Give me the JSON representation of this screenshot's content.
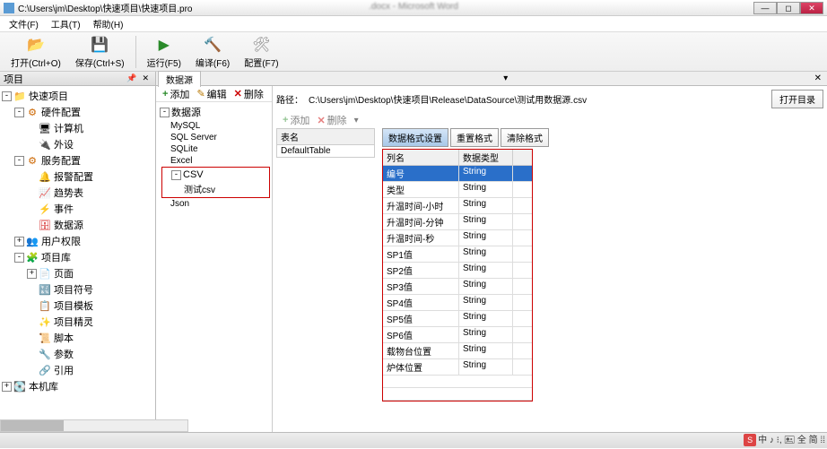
{
  "window": {
    "title": "C:\\Users\\jm\\Desktop\\快速项目\\快速项目.pro",
    "blur_title": ".docx - Microsoft Word"
  },
  "menu": {
    "file": "文件(F)",
    "tool": "工具(T)",
    "help": "帮助(H)"
  },
  "toolbar": {
    "open": "打开(Ctrl+O)",
    "save": "保存(Ctrl+S)",
    "run": "运行(F5)",
    "compile": "编译(F6)",
    "config": "配置(F7)"
  },
  "project_panel": {
    "title": "项目",
    "root": "快速项目",
    "hw_config": "硬件配置",
    "computer": "计算机",
    "peripheral": "外设",
    "svc_config": "服务配置",
    "alarm_config": "报警配置",
    "trend_table": "趋势表",
    "event": "事件",
    "data_source": "数据源",
    "user_perm": "用户权限",
    "project_lib": "项目库",
    "page": "页面",
    "symbol": "项目符号",
    "template": "项目模板",
    "wizard": "项目精灵",
    "script": "脚本",
    "param": "参数",
    "ref": "引用",
    "local_lib": "本机库"
  },
  "datasource": {
    "tab": "数据源",
    "actions": {
      "add": "添加",
      "edit": "编辑",
      "del": "删除"
    },
    "tree_root": "数据源",
    "types": [
      "MySQL",
      "SQL Server",
      "SQLite",
      "Excel",
      "CSV",
      "Json"
    ],
    "csv_item": "测试csv",
    "path_label": "路径：",
    "path_value": "C:\\Users\\jm\\Desktop\\快速项目\\Release\\DataSource\\测试用数据源.csv",
    "open_dir": "打开目录",
    "table_name_hdr": "表名",
    "table_name": "DefaultTable",
    "format_tab": "数据格式设置",
    "reset_btn": "重置格式",
    "clear_btn": "清除格式",
    "col_hdr_name": "列名",
    "col_hdr_type": "数据类型",
    "rows": [
      {
        "name": "编号",
        "type": "String"
      },
      {
        "name": "类型",
        "type": "String"
      },
      {
        "name": "升温时间-小时",
        "type": "String"
      },
      {
        "name": "升温时间-分钟",
        "type": "String"
      },
      {
        "name": "升温时间-秒",
        "type": "String"
      },
      {
        "name": "SP1值",
        "type": "String"
      },
      {
        "name": "SP2值",
        "type": "String"
      },
      {
        "name": "SP3值",
        "type": "String"
      },
      {
        "name": "SP4值",
        "type": "String"
      },
      {
        "name": "SP5值",
        "type": "String"
      },
      {
        "name": "SP6值",
        "type": "String"
      },
      {
        "name": "载物台位置",
        "type": "String"
      },
      {
        "name": "炉体位置",
        "type": "String"
      }
    ]
  },
  "tray": {
    "ime": "S",
    "status": "中 ♪ ⁝, 🖭 全 简 ⁞⁞"
  }
}
